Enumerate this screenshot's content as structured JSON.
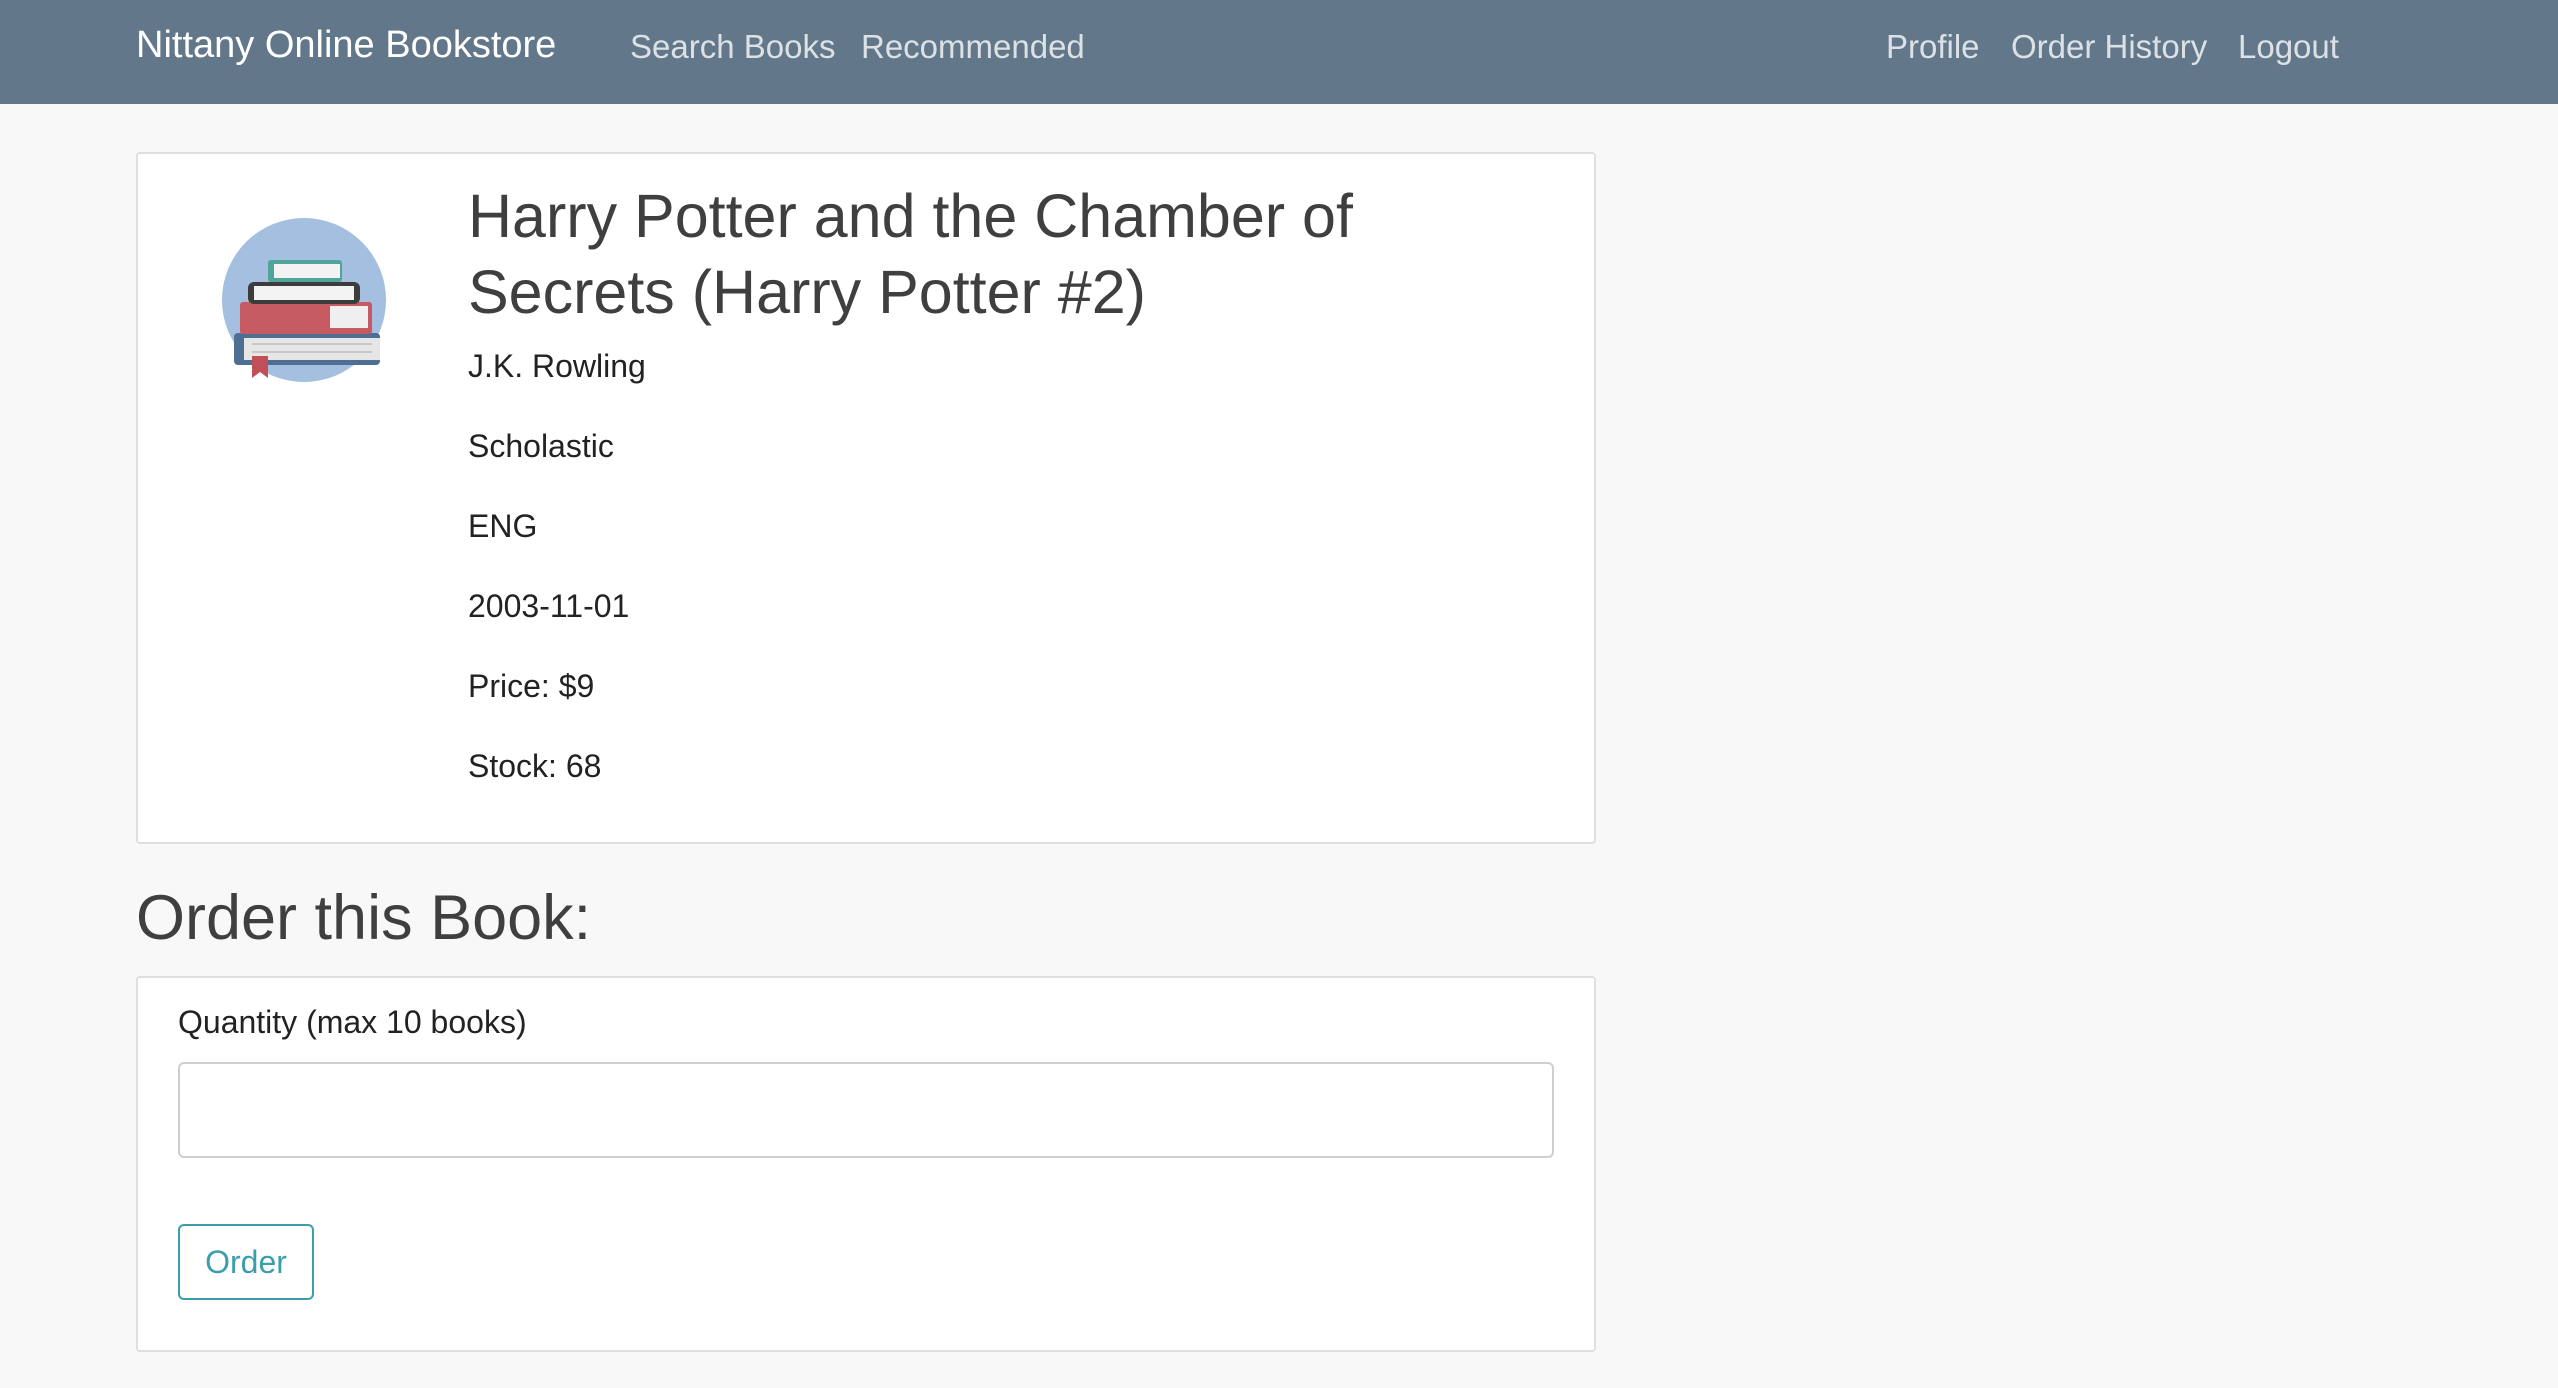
{
  "navbar": {
    "brand": "Nittany Online Bookstore",
    "left_links": [
      "Search Books",
      "Recommended"
    ],
    "right_links": [
      "Profile",
      "Order History",
      "Logout"
    ],
    "background_color": "#627789"
  },
  "book": {
    "cover_icon": "book-stack-icon",
    "title": "Harry Potter and the Chamber of Secrets (Harry Potter #2)",
    "author": "J.K. Rowling",
    "publisher": "Scholastic",
    "language": "ENG",
    "publish_date": "2003-11-01",
    "price": "Price: $9",
    "stock": "Stock: 68"
  },
  "order": {
    "heading": "Order this Book:",
    "quantity_label": "Quantity (max 10 books)",
    "quantity_value": "",
    "quantity_placeholder": "",
    "button_label": "Order",
    "accent_color": "#3a9fab"
  }
}
